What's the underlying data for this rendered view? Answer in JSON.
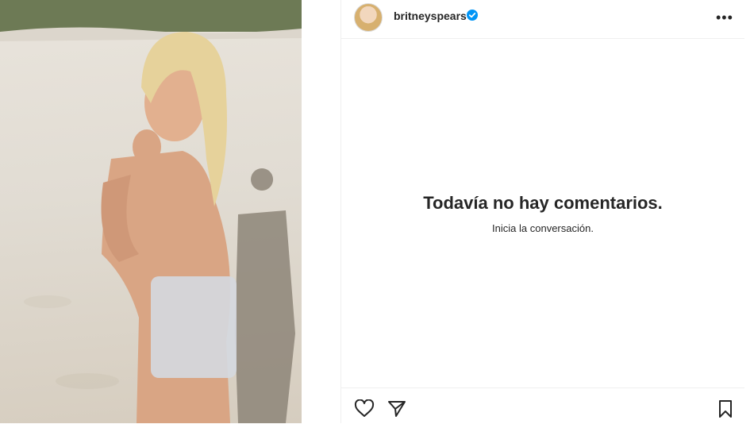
{
  "post": {
    "username": "britneyspears",
    "verified_icon": "verified-badge-icon",
    "more_icon": "more-options-icon",
    "more_glyph": "•••"
  },
  "comments": {
    "empty_title": "Todavía no hay comentarios.",
    "empty_subtitle": "Inicia la conversación."
  },
  "actions": {
    "like_icon": "heart-icon",
    "share_icon": "send-icon",
    "save_icon": "bookmark-icon"
  },
  "colors": {
    "accent": "#0095f6",
    "text": "#262626",
    "border": "#efefef"
  }
}
